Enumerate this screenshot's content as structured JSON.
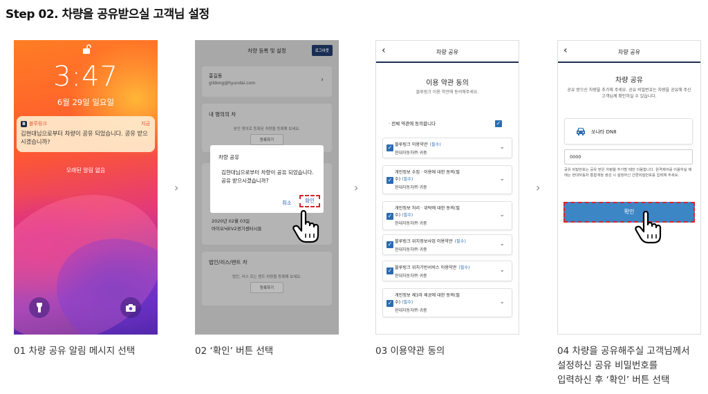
{
  "step_title": "Step 02. 차량을 공유받으실 고객님 설정",
  "colors": {
    "navy": "#1a2d52",
    "accent_blue": "#3d86c6",
    "highlight_red": "#d9232a"
  },
  "panel1": {
    "time": "3:47",
    "date": "6월 29일 일요일",
    "notification": {
      "app_name": "블루링크",
      "app_badge": "B",
      "time": "지금",
      "message": "김현대님으로부터 차량이 공유 되었습니다. 공유 받으시겠습니까?"
    },
    "no_older": "오래된 알림 없음",
    "icons": [
      "padlock-icon",
      "flashlight-icon",
      "camera-icon"
    ]
  },
  "panel2": {
    "header_title": "차량 등록 및 설정",
    "logout": "로그아웃",
    "user_name": "홍길동",
    "user_email": "gildong@hyundai.com",
    "my_cars_title": "내 명의의 차",
    "my_cars_desc": "본인 명의로 등록된 차량을 등록해 보세요.",
    "register": "등록하기",
    "shared_car_date": "2020년 02월 03일",
    "shared_car_name": "아이오닉EV2경기센터시들",
    "corp_title": "법인/리스/렌트 차",
    "corp_desc": "법인, 리스 또는 렌트 차량을 등록해 보세요.",
    "modal": {
      "title": "차량 공유",
      "message": "김현대님으로부터 차량이 공유 되었습니다. 공유 받으시겠습니까?",
      "cancel": "취소",
      "confirm": "확인"
    }
  },
  "panel3": {
    "header_title": "차량 공유",
    "title": "이용 약관 동의",
    "subtitle": "블루링크 이용 약관에 동의해주세요.",
    "agree_all": "· 전체 약관에 동의합니다",
    "terms": [
      {
        "line1": "블루링크 이용약관",
        "line2": "",
        "required": "(필수)",
        "org": "현대자동차㈜ 귀중"
      },
      {
        "line1": "개인정보 수집 · 이용에 대한 동의(필",
        "line2": "수)",
        "required": "(필수)",
        "org": "현대자동차㈜ 귀중"
      },
      {
        "line1": "개인정보 처리 · 위탁에 대한 동의(필",
        "line2": "수)",
        "required": "(필수)",
        "org": "현대자동차㈜ 귀중"
      },
      {
        "line1": "블루링크 위치정보사업 이용약관",
        "line2": "",
        "required": "(필수)",
        "org": "현대자동차㈜ 귀중"
      },
      {
        "line1": "블루링크 위치기반서비스 이용약관",
        "line2": "",
        "required": "(필수)",
        "org": "현대자동차㈜ 귀중"
      },
      {
        "line1": "개인정보 제3자 제공에 대한 동의(필",
        "line2": "수)",
        "required": "(필수)",
        "org": "현대자동차㈜ 귀중"
      }
    ]
  },
  "panel4": {
    "header_title": "차량 공유",
    "title": "차량 공유",
    "subtitle": "공유 받으신 차량을 추가해 주세요. 공유 비밀번호는 차량을 공유해 주신 고객님께 확인하실 수 있습니다.",
    "car_name": "쏘나타 DN8",
    "password": "0000",
    "note": "공유 비밀번호는 공유 받은 차량을 추가할 때만 이용합니다. 원격제어를 이용하실 때에는 현대자동차 통합계정 생성 시 설정하신 간편비밀번호를 입력해 주세요.",
    "confirm": "확인"
  },
  "captions": {
    "c1": "01 차량 공유 알림 메시지 선택",
    "c2": "02 ‘확인’ 버튼 선택",
    "c3": "03 이용약관 동의",
    "c4_l1": "04 차량을 공유해주실 고객님께서",
    "c4_l2": "설정하신 공유 비밀번호를",
    "c4_l3": "입력하신 후 ‘확인’ 버튼 선택"
  }
}
